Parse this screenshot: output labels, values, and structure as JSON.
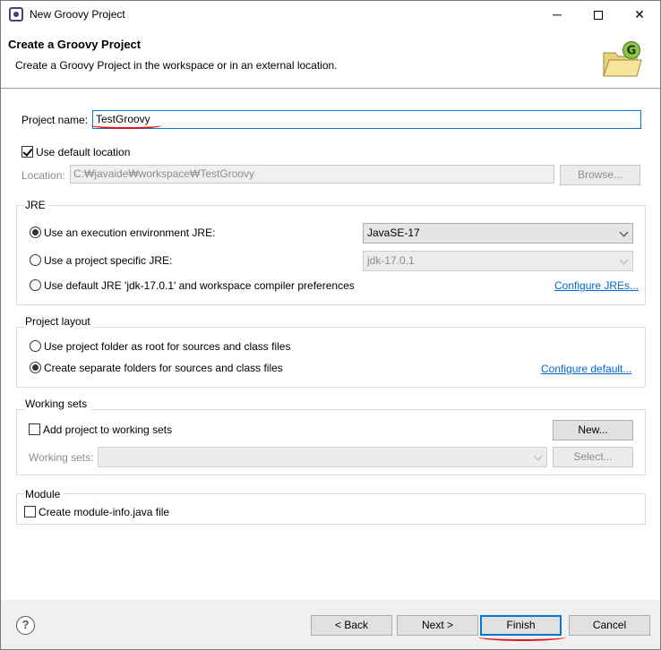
{
  "window": {
    "title": "New Groovy Project",
    "minimize": "─",
    "close": "✕"
  },
  "header": {
    "title": "Create a Groovy Project",
    "description": "Create a Groovy Project in the workspace or in an external location.",
    "icon_letter": "G"
  },
  "project": {
    "name_label": "Project name:",
    "name_value": "TestGroovy"
  },
  "location": {
    "use_default_label": "Use default location",
    "use_default_checked": true,
    "location_label": "Location:",
    "location_value": "C:₩javaide₩workspace₩TestGroovy",
    "browse_label": "Browse..."
  },
  "jre": {
    "group_title": "JRE",
    "option_env_label": "Use an execution environment JRE:",
    "option_env_value": "JavaSE-17",
    "option_specific_label": "Use a project specific JRE:",
    "option_specific_value": "jdk-17.0.1",
    "option_default_label": "Use default JRE 'jdk-17.0.1' and workspace compiler preferences",
    "configure_link": "Configure JREs...",
    "selected": "env"
  },
  "layout": {
    "group_title": "Project layout",
    "option_root_label": "Use project folder as root for sources and class files",
    "option_separate_label": "Create separate folders for sources and class files",
    "configure_link": "Configure default...",
    "selected": "separate"
  },
  "working_sets": {
    "group_title": "Working sets",
    "add_label": "Add project to working sets",
    "add_checked": false,
    "new_button": "New...",
    "sets_label": "Working sets:",
    "select_button": "Select..."
  },
  "module": {
    "group_title": "Module",
    "create_label": "Create module-info.java file",
    "create_checked": false
  },
  "footer": {
    "help": "?",
    "back": "< Back",
    "next": "Next >",
    "finish": "Finish",
    "cancel": "Cancel"
  },
  "colors": {
    "accent": "#0078d7",
    "link": "#0066cc",
    "annotation": "#e0101a"
  }
}
